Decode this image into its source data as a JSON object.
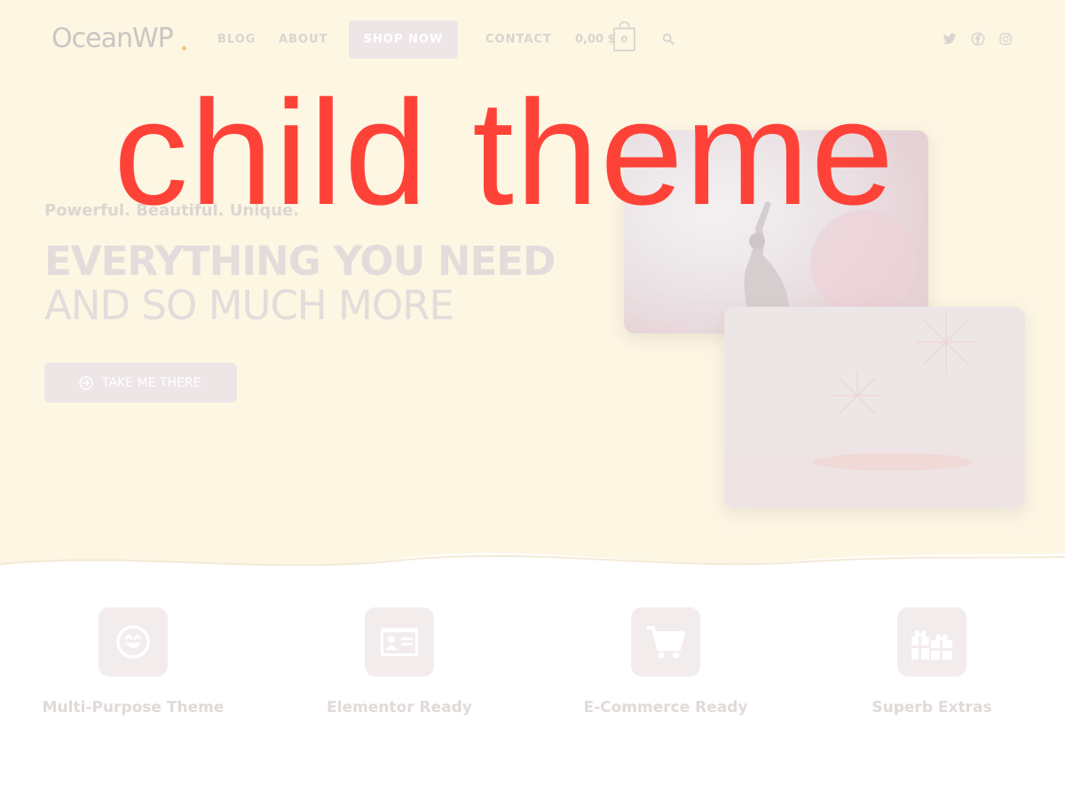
{
  "header": {
    "logo": "OceanWP",
    "nav": {
      "blog": "BLOG",
      "about": "ABOUT",
      "shop_now": "SHOP NOW",
      "contact": "CONTACT"
    },
    "cart": {
      "total": "0,00 $",
      "count": "0"
    },
    "icons": [
      "search-icon",
      "twitter-icon",
      "facebook-icon",
      "instagram-icon"
    ]
  },
  "overlay": {
    "text": "child theme",
    "color": "#ff4238"
  },
  "hero": {
    "tagline": "Powerful. Beautiful. Unique.",
    "headline_bold": "EVERYTHING YOU NEED",
    "headline_light": "AND SO MUCH MORE",
    "cta_label": "TAKE ME THERE",
    "background": "#fdf6e3"
  },
  "features": [
    {
      "icon": "smiley-icon",
      "label": "Multi-Purpose Theme"
    },
    {
      "icon": "id-card-icon",
      "label": "Elementor Ready"
    },
    {
      "icon": "cart-icon",
      "label": "E-Commerce Ready"
    },
    {
      "icon": "gift-icon",
      "label": "Superb Extras"
    }
  ]
}
